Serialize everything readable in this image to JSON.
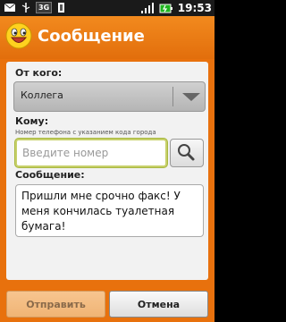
{
  "status_bar": {
    "network": "3G",
    "time": "19:53"
  },
  "title_bar": {
    "title": "Сообщение",
    "avatar_icon": "smiley-face-icon"
  },
  "form": {
    "from_label": "От кого:",
    "from_value": "Коллега",
    "to_label": "Кому:",
    "to_hint": "Номер телефона с указанием кода города",
    "number_placeholder": "Введите номер",
    "message_label": "Сообщение:",
    "message_text": "Пришли мне срочно факс! У меня кончилась туалетная бумага!"
  },
  "buttons": {
    "send_label": "Отправить",
    "cancel_label": "Отмена"
  },
  "colors": {
    "accent": "#e8710d",
    "input_focus": "#c7d06a"
  }
}
